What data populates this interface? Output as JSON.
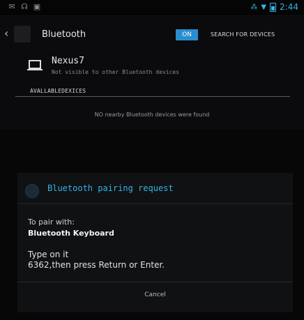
{
  "status_bar": {
    "time": "2:44",
    "colors": {
      "accent": "#33b5e5"
    },
    "left_icons": [
      "notification-icon",
      "headset-icon",
      "image-icon"
    ],
    "right_icons": [
      "bluetooth-icon",
      "wifi-icon",
      "battery-icon"
    ]
  },
  "action_bar": {
    "title": "Bluetooth",
    "toggle_label": "ON",
    "search_label": "SEARCH FOR DEVICES"
  },
  "device": {
    "name": "Nexus7",
    "status": "Not visible to other Bluetooth devices",
    "icon": "laptop-icon"
  },
  "available_section": {
    "header": "AVALLABLEDEXICES",
    "empty_message": "NO nearby Bluetooth devices were found"
  },
  "dialog": {
    "title": "Bluetooth pairing request",
    "pair_label": "To pair with:",
    "pair_device": "Bluetooth Keyboard",
    "instruction_line1": "Type on it",
    "instruction_line2": "6362,then press Return or Enter.",
    "cancel_label": "Cancel"
  },
  "colors": {
    "background": "#0b0b0d",
    "toggle_on": "#2b8cd0",
    "dialog_title": "#33b5e5"
  }
}
